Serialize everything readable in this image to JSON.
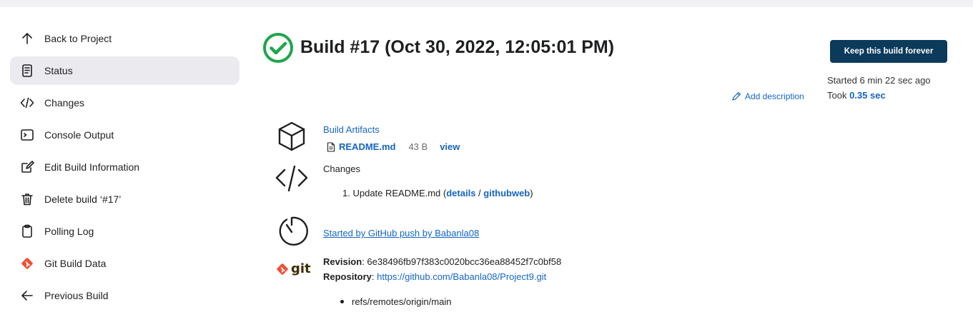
{
  "sidebar": {
    "items": [
      {
        "label": "Back to Project",
        "icon": "arrow-up-icon"
      },
      {
        "label": "Status",
        "icon": "document-icon",
        "active": true
      },
      {
        "label": "Changes",
        "icon": "code-icon"
      },
      {
        "label": "Console Output",
        "icon": "terminal-icon"
      },
      {
        "label": "Edit Build Information",
        "icon": "edit-icon"
      },
      {
        "label": "Delete build ‘#17’",
        "icon": "trash-icon"
      },
      {
        "label": "Polling Log",
        "icon": "clipboard-icon"
      },
      {
        "label": "Git Build Data",
        "icon": "git-icon"
      },
      {
        "label": "Previous Build",
        "icon": "arrow-left-icon"
      }
    ]
  },
  "header": {
    "title": "Build #17 (Oct 30, 2022, 12:05:01 PM)",
    "status_color": "#1ea64b",
    "keep_button": "Keep this build forever",
    "add_description": "Add description",
    "started": "Started 6 min 22 sec ago",
    "took_prefix": "Took ",
    "took_value": "0.35 sec",
    "button_color": "#0b3a5b"
  },
  "artifacts": {
    "title": "Build Artifacts",
    "file_name": "README.md",
    "file_size": "43 B",
    "view_label": "view"
  },
  "changes": {
    "title": "Changes",
    "item_number": "1.",
    "item_text": "Update README.md (",
    "details_label": "details",
    "separator": " / ",
    "githubweb_label": "githubweb",
    "close_paren": ")"
  },
  "trigger": {
    "text": "Started by GitHub push by Babanla08"
  },
  "git": {
    "logo_text": "git",
    "revision_label": "Revision",
    "revision_value": ": 6e38496fb97f383c0020bcc36ea88452f7c0bf58",
    "repository_label": "Repository",
    "repository_sep": ": ",
    "repository_url": "https://github.com/Babanla08/Project9.git",
    "refs": [
      "refs/remotes/origin/main"
    ]
  }
}
